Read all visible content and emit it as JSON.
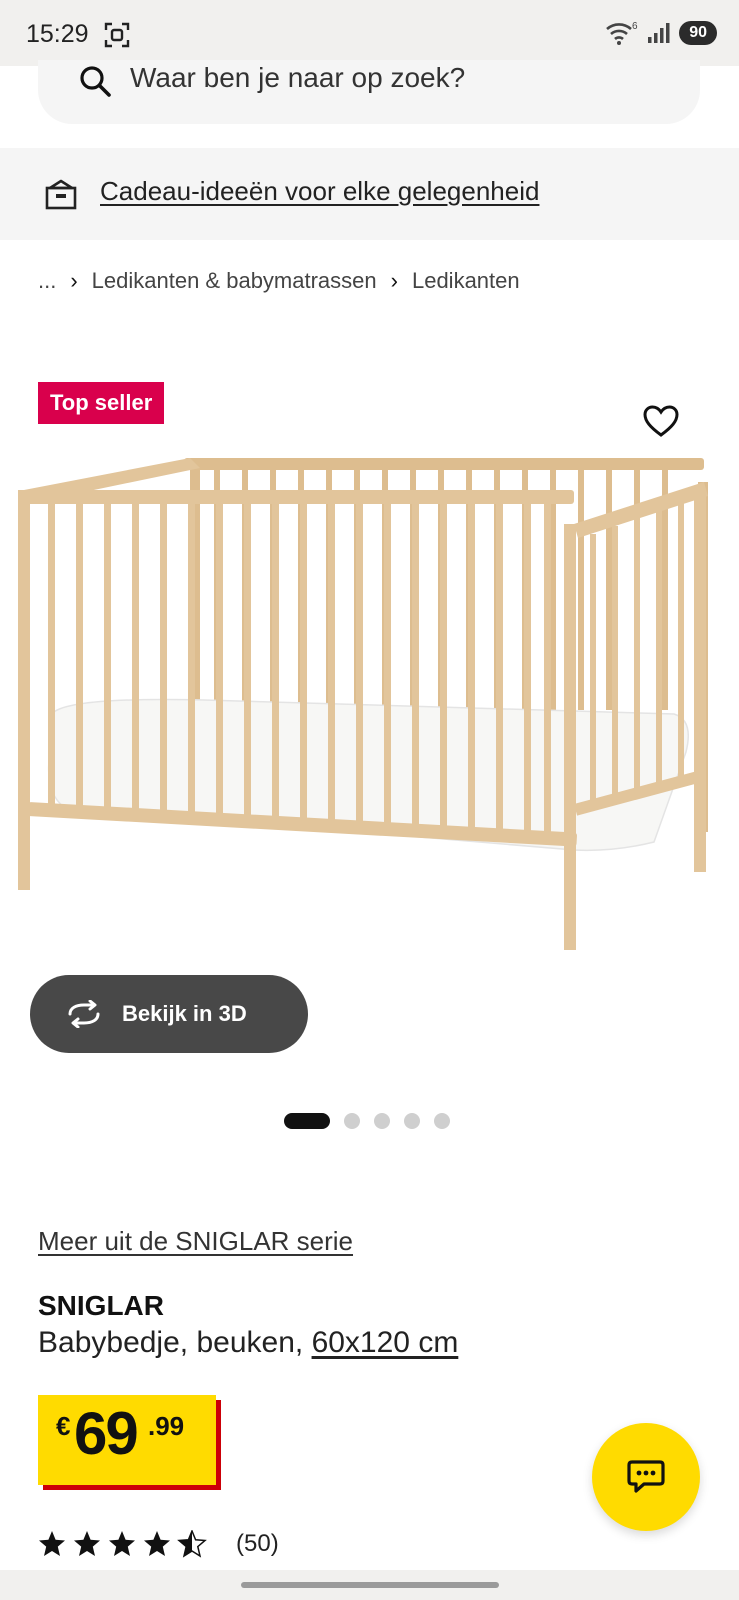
{
  "status_bar": {
    "time": "15:29",
    "wifi_badge": "6",
    "battery": "90"
  },
  "search": {
    "placeholder": "Waar ben je naar op zoek?"
  },
  "gift_banner": {
    "link_text": "Cadeau-ideeën voor elke gelegenheid"
  },
  "breadcrumb": {
    "ellipsis": "...",
    "items": [
      "Ledikanten & babymatrassen",
      "Ledikanten"
    ]
  },
  "product": {
    "badge": "Top seller",
    "view_3d_label": "Bekijk in 3D",
    "carousel": {
      "total_images": 5,
      "active_index": 0
    },
    "series_link": "Meer uit de SNIGLAR serie",
    "name": "SNIGLAR",
    "description": "Babybedje, beuken,",
    "size": "60x120 cm",
    "price": {
      "currency": "€",
      "integer": "69",
      "decimal": ".99"
    },
    "rating": {
      "stars": 4.5,
      "max": 5,
      "count": "(50)"
    }
  },
  "colors": {
    "accent_yellow": "#ffdb00",
    "price_shadow_red": "#cc0008",
    "badge_pink": "#d9004c",
    "button_dark": "#484848"
  },
  "icons": [
    "qr-scan-icon",
    "wifi-icon",
    "signal-icon",
    "search-icon",
    "gift-icon",
    "heart-icon",
    "rotate-3d-icon",
    "chat-icon",
    "star-icon"
  ]
}
